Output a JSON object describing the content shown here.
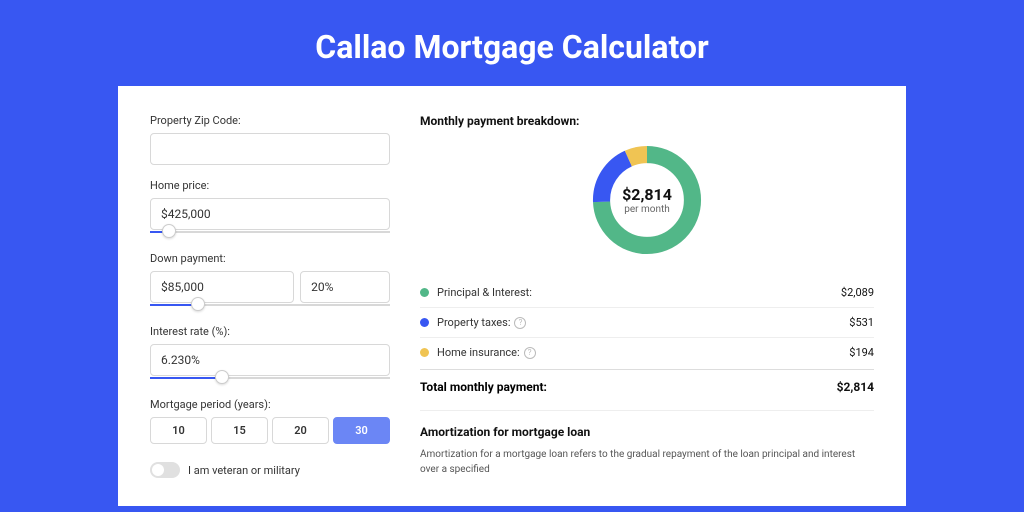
{
  "header": {
    "title": "Callao Mortgage Calculator"
  },
  "form": {
    "zip_label": "Property Zip Code:",
    "zip_value": "",
    "home_price_label": "Home price:",
    "home_price_value": "$425,000",
    "home_price_slider_pct": 8,
    "down_payment_label": "Down payment:",
    "down_payment_value": "$85,000",
    "down_payment_pct_value": "20%",
    "down_payment_slider_pct": 20,
    "interest_label": "Interest rate (%):",
    "interest_value": "6.230%",
    "interest_slider_pct": 30,
    "period_label": "Mortgage period (years):",
    "periods": [
      "10",
      "15",
      "20",
      "30"
    ],
    "period_active": "30",
    "veteran_label": "I am veteran or military"
  },
  "breakdown": {
    "title": "Monthly payment breakdown:",
    "center_value": "$2,814",
    "center_sub": "per month",
    "items": [
      {
        "label": "Principal & Interest:",
        "value": "$2,089",
        "color": "green",
        "info": false
      },
      {
        "label": "Property taxes:",
        "value": "$531",
        "color": "blue",
        "info": true
      },
      {
        "label": "Home insurance:",
        "value": "$194",
        "color": "yellow",
        "info": true
      }
    ],
    "total_label": "Total monthly payment:",
    "total_value": "$2,814"
  },
  "chart_data": {
    "type": "pie",
    "title": "Monthly payment breakdown",
    "series": [
      {
        "name": "Principal & Interest",
        "value": 2089,
        "color": "#52b788"
      },
      {
        "name": "Property taxes",
        "value": 531,
        "color": "#3857f2"
      },
      {
        "name": "Home insurance",
        "value": 194,
        "color": "#f0c453"
      }
    ],
    "total": 2814
  },
  "amort": {
    "title": "Amortization for mortgage loan",
    "text": "Amortization for a mortgage loan refers to the gradual repayment of the loan principal and interest over a specified"
  }
}
